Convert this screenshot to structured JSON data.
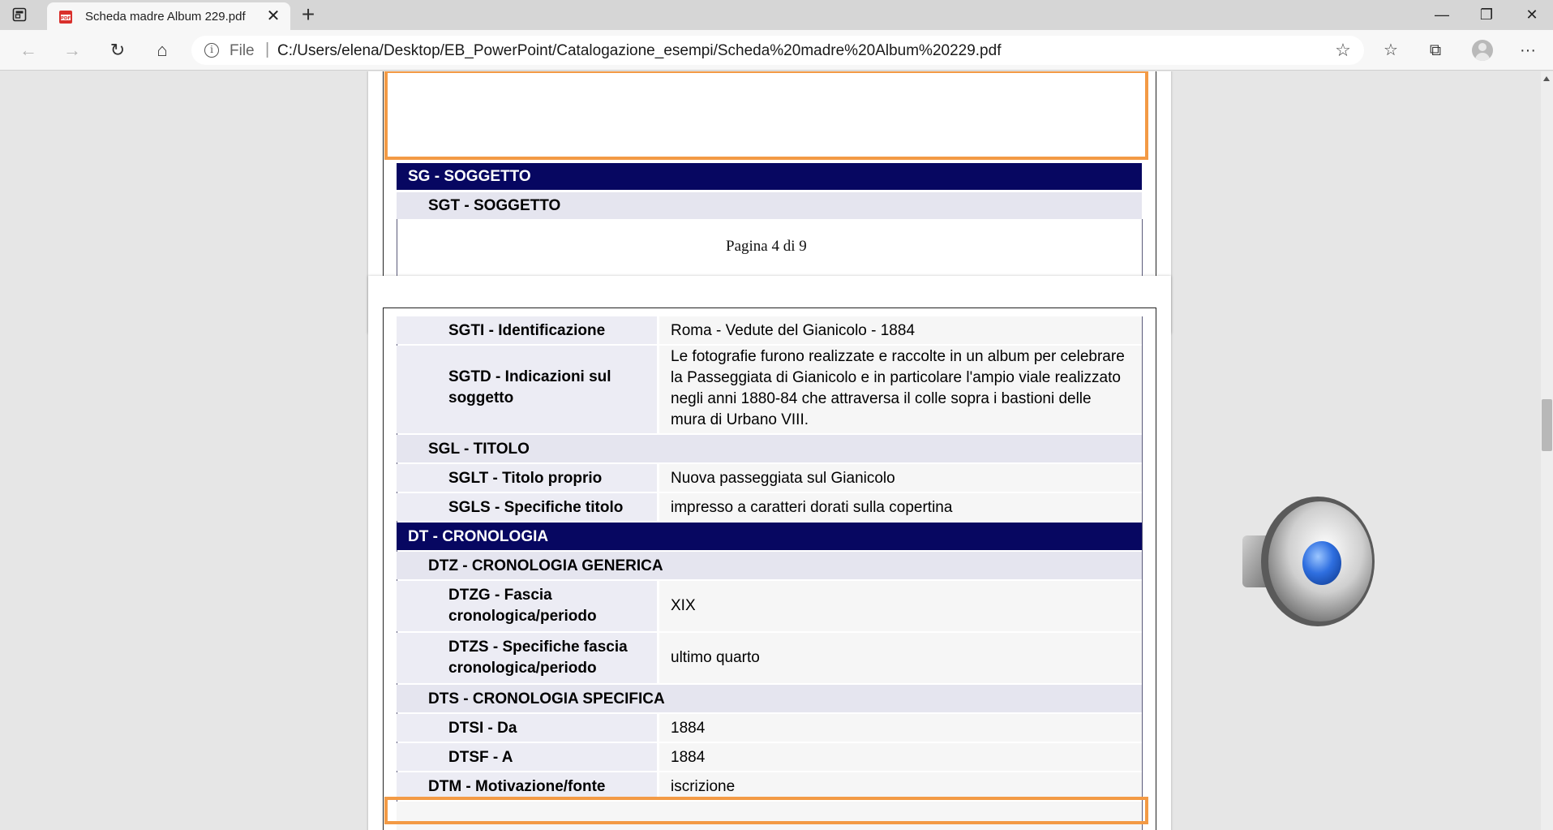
{
  "browser": {
    "tab": {
      "title": "Scheda madre Album 229.pdf",
      "close": "✕"
    },
    "new_tab": "+",
    "window": {
      "minimize": "—",
      "restore": "❐",
      "close": "✕"
    },
    "nav": {
      "back": "←",
      "forward": "→",
      "reload": "↻",
      "home": "⌂"
    },
    "address": {
      "scheme_label": "File",
      "separator": "|",
      "url": "C:/Users/elena/Desktop/EB_PowerPoint/Catalogazione_esempi/Scheda%20madre%20Album%20229.pdf",
      "favorite": "☆"
    },
    "toolbar_icons": {
      "favorites": "☆",
      "collections": "⧉",
      "more": "···"
    }
  },
  "document": {
    "page4": {
      "rows": [
        {
          "type": "section",
          "text": "SG - SOGGETTO"
        },
        {
          "type": "sub",
          "text": "SGT - SOGGETTO"
        }
      ],
      "footer": "Pagina 4 di 9"
    },
    "page5": {
      "rows": [
        {
          "label": "SGTI - Identificazione",
          "value": "Roma - Vedute del Gianicolo - 1884"
        },
        {
          "label": "SGTD - Indicazioni sul soggetto",
          "value": "Le fotografie furono realizzate e raccolte in un album per celebrare la Passeggiata di Gianicolo e in particolare l'ampio viale realizzato negli anni 1880-84 che attraversa il colle sopra i bastioni delle mura di Urbano VIII."
        },
        {
          "sub": "SGL - TITOLO"
        },
        {
          "label": "SGLT - Titolo proprio",
          "value": "Nuova passeggiata sul Gianicolo"
        },
        {
          "label": "SGLS - Specifiche titolo",
          "value": "impresso a caratteri dorati sulla copertina"
        },
        {
          "section": "DT - CRONOLOGIA"
        },
        {
          "sub": "DTZ - CRONOLOGIA GENERICA"
        },
        {
          "label": "DTZG - Fascia cronologica/periodo",
          "value": "XIX"
        },
        {
          "label": "DTZS - Specifiche fascia cronologica/periodo",
          "value": "ultimo quarto"
        },
        {
          "sub": "DTS - CRONOLOGIA SPECIFICA"
        },
        {
          "label": "DTSI - Da",
          "value": "1884"
        },
        {
          "label": "DTSF - A",
          "value": "1884"
        },
        {
          "label": "DTM - Motivazione/fonte",
          "value": "iscrizione"
        }
      ]
    }
  },
  "colors": {
    "section_bg": "#070761",
    "highlight": "#f39a45"
  },
  "icons": {
    "audio": "speaker-icon"
  }
}
